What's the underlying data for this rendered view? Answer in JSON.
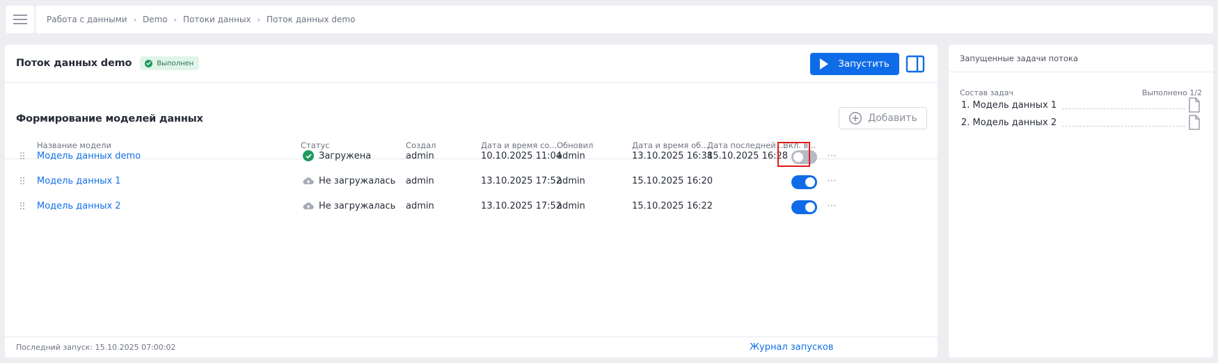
{
  "breadcrumb": [
    "Работа с данными",
    "Demo",
    "Потоки данных",
    "Поток данных demo"
  ],
  "header": {
    "title": "Поток данных demo",
    "status_badge": "Выполнен",
    "run_button": "Запустить"
  },
  "section": {
    "title": "Формирование моделей данных",
    "add_button": "Добавить"
  },
  "table": {
    "columns": [
      "Название модели",
      "Статус",
      "Создал",
      "Дата и время со...",
      "Обновил",
      "Дата и время об...",
      "Дата последней ...",
      "Вкл. в..."
    ],
    "rows": [
      {
        "name": "Модель данных demo",
        "status": "Загружена",
        "status_icon": "check-circle-icon",
        "created_by": "admin",
        "created_at": "10.10.2025 11:04",
        "updated_by": "admin",
        "updated_at": "13.10.2025 16:38",
        "last_load": "15.10.2025 16:28",
        "enabled": false
      },
      {
        "name": "Модель данных 1",
        "status": "Не загружалась",
        "status_icon": "cloud-upload-icon",
        "created_by": "admin",
        "created_at": "13.10.2025 17:52",
        "updated_by": "admin",
        "updated_at": "15.10.2025 16:20",
        "last_load": "",
        "enabled": true
      },
      {
        "name": "Модель данных 2",
        "status": "Не загружалась",
        "status_icon": "cloud-upload-icon",
        "created_by": "admin",
        "created_at": "13.10.2025 17:52",
        "updated_by": "admin",
        "updated_at": "15.10.2025 16:22",
        "last_load": "",
        "enabled": true
      }
    ]
  },
  "footer": {
    "last_run": "Последний запуск: 15.10.2025 07:00:02",
    "journal_link": "Журнал запусков"
  },
  "side_panel": {
    "title": "Запущенные задачи потока",
    "tasks_label": "Состав задач",
    "completed": "Выполнено 1/2",
    "tasks": [
      "1. Модель данных 1",
      "2. Модель данных 2"
    ]
  },
  "colors": {
    "accent": "#0f6ce8",
    "success": "#1f9a5c",
    "highlight": "#e01919"
  }
}
